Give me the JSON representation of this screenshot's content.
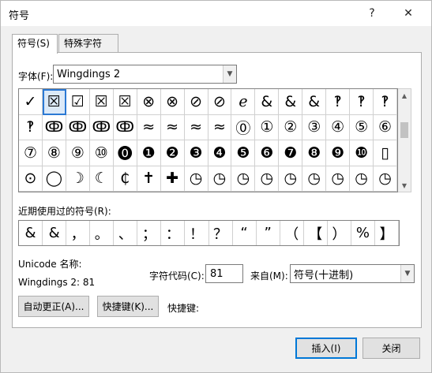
{
  "window": {
    "title": "符号",
    "help_label": "?",
    "close_label": "✕"
  },
  "tabs": [
    {
      "label": "符号(S)"
    },
    {
      "label": "特殊字符(P)"
    }
  ],
  "font": {
    "label": "字体(F):",
    "value": "Wingdings 2"
  },
  "symbols": [
    [
      "✓",
      "☒",
      "☑",
      "☒",
      "☒",
      "⊗",
      "⊗",
      "⊘",
      "⊘",
      "ℯ",
      "&",
      "&",
      "&",
      "‽",
      "‽",
      "‽"
    ],
    [
      "‽",
      "ↂ",
      "ↂ",
      "ↂ",
      "ↂ",
      "≈",
      "≈",
      "≈",
      "≈",
      "⓪",
      "①",
      "②",
      "③",
      "④",
      "⑤",
      "⑥"
    ],
    [
      "⑦",
      "⑧",
      "⑨",
      "⑩",
      "⓿",
      "❶",
      "❷",
      "❸",
      "❹",
      "❺",
      "❻",
      "❼",
      "❽",
      "❾",
      "❿",
      "▯"
    ],
    [
      "⊙",
      "◯",
      "☽",
      "☾",
      "₵",
      "✝",
      "✚",
      "◷",
      "◷",
      "◷",
      "◷",
      "◷",
      "◷",
      "◷",
      "◷",
      "◷"
    ]
  ],
  "selected_index": 1,
  "recent": {
    "label": "近期使用过的符号(R):",
    "symbols": [
      "&",
      "&",
      "，",
      "。",
      "、",
      "；",
      "：",
      "！",
      "？",
      "“",
      "”",
      "（",
      "【",
      "）",
      "%",
      "】"
    ]
  },
  "unicode_name_label": "Unicode 名称:",
  "char_name": "Wingdings 2: 81",
  "char_code": {
    "label": "字符代码(C):",
    "value": "81"
  },
  "from": {
    "label": "来自(M):",
    "value": "符号(十进制)"
  },
  "buttons": {
    "autocorrect": "自动更正(A)...",
    "shortcut_key": "快捷键(K)...",
    "shortcut_label": "快捷键:",
    "insert": "插入(I)",
    "close": "关闭"
  }
}
